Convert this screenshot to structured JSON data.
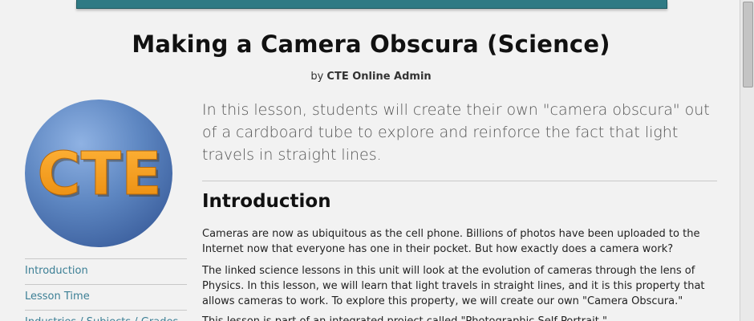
{
  "article": {
    "title": "Making a Camera Obscura (Science)",
    "byline_prefix": "by",
    "author": "CTE Online Admin",
    "logo_text": "CTE",
    "summary": "In this lesson, students will create their own \"camera obscura\" out of a cardboard tube to explore and reinforce the fact that light travels in straight lines.",
    "section_heading": "Introduction",
    "paragraphs": [
      "Cameras are now as ubiquitous as the cell phone. Billions of photos have been uploaded to the Internet now that everyone has one in their pocket. But how exactly does a camera work?",
      "The linked science lessons in this unit will look at the evolution of cameras through the lens of Physics. In this lesson, we will learn that light travels in straight lines, and it is this property that allows cameras to work. To explore this property, we will create our own \"Camera Obscura.\"",
      "This lesson is part of an integrated project called \"Photographic Self Portrait.\""
    ]
  },
  "toc": {
    "items": [
      {
        "label": "Introduction"
      },
      {
        "label": "Lesson Time"
      },
      {
        "label": "Industries / Subjects / Grades"
      }
    ]
  },
  "colors": {
    "header_bar": "#2f7a84",
    "link": "#3c7f95",
    "logo_orange": "#f39a1c",
    "logo_blue": "#4d79b5"
  },
  "icons": {
    "logo": "cte-circle-logo"
  }
}
